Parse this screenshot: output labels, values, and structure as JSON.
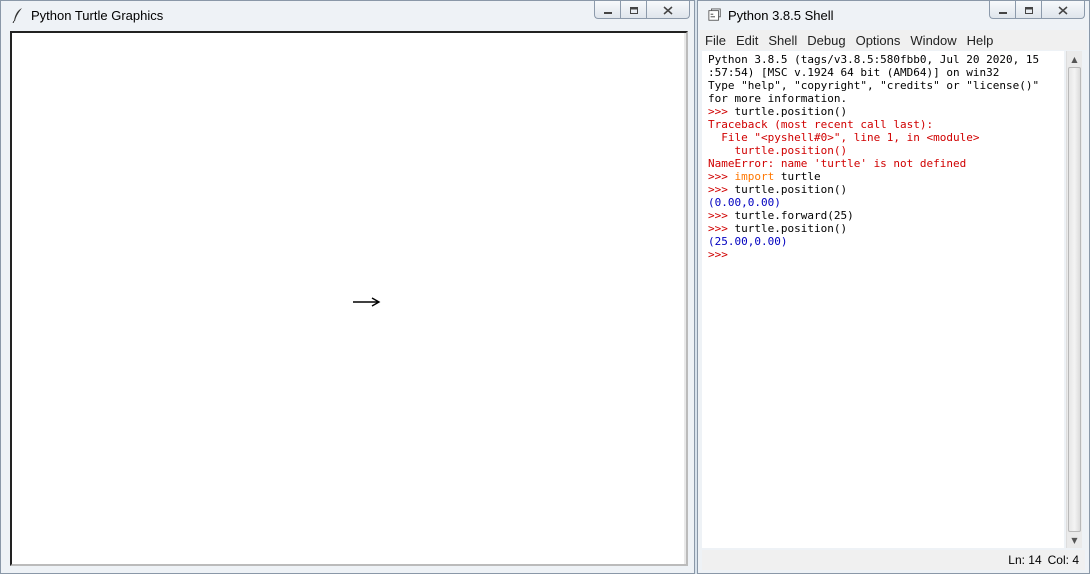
{
  "turtle_window": {
    "title": "Python Turtle Graphics",
    "icon": "feather-icon"
  },
  "shell_window": {
    "title": "Python 3.8.5 Shell",
    "icon": "python-shell-icon",
    "menu": [
      "File",
      "Edit",
      "Shell",
      "Debug",
      "Options",
      "Window",
      "Help"
    ],
    "lines": [
      {
        "segments": [
          {
            "text": "Python 3.8.5 (tags/v3.8.5:580fbb0, Jul 20 2020, 15",
            "color": "black"
          }
        ]
      },
      {
        "segments": [
          {
            "text": ":57:54) [MSC v.1924 64 bit (AMD64)] on win32",
            "color": "black"
          }
        ]
      },
      {
        "segments": [
          {
            "text": "Type \"help\", \"copyright\", \"credits\" or \"license()\"",
            "color": "black"
          }
        ]
      },
      {
        "segments": [
          {
            "text": "for more information.",
            "color": "black"
          }
        ]
      },
      {
        "segments": [
          {
            "text": ">>> ",
            "color": "red"
          },
          {
            "text": "turtle.position()",
            "color": "black"
          }
        ]
      },
      {
        "segments": [
          {
            "text": "Traceback (most recent call last):",
            "color": "red"
          }
        ]
      },
      {
        "segments": [
          {
            "text": "  File \"<pyshell#0>\", line 1, in <module>",
            "color": "red"
          }
        ]
      },
      {
        "segments": [
          {
            "text": "    turtle.position()",
            "color": "red"
          }
        ]
      },
      {
        "segments": [
          {
            "text": "NameError: name 'turtle' is not defined",
            "color": "red"
          }
        ]
      },
      {
        "segments": [
          {
            "text": ">>> ",
            "color": "red"
          },
          {
            "text": "import",
            "color": "orange"
          },
          {
            "text": " turtle",
            "color": "black"
          }
        ]
      },
      {
        "segments": [
          {
            "text": ">>> ",
            "color": "red"
          },
          {
            "text": "turtle.position()",
            "color": "black"
          }
        ]
      },
      {
        "segments": [
          {
            "text": "(0.00,0.00)",
            "color": "blue"
          }
        ]
      },
      {
        "segments": [
          {
            "text": ">>> ",
            "color": "red"
          },
          {
            "text": "turtle.forward(25)",
            "color": "black"
          }
        ]
      },
      {
        "segments": [
          {
            "text": ">>> ",
            "color": "red"
          },
          {
            "text": "turtle.position()",
            "color": "black"
          }
        ]
      },
      {
        "segments": [
          {
            "text": "(25.00,0.00)",
            "color": "blue"
          }
        ]
      },
      {
        "segments": [
          {
            "text": ">>> ",
            "color": "red"
          }
        ]
      }
    ],
    "status": {
      "line": "Ln: 14",
      "col": "Col: 4"
    }
  },
  "colors": {
    "prompt": "#d00000",
    "keyword": "#ff7700",
    "output": "#0000c0"
  }
}
